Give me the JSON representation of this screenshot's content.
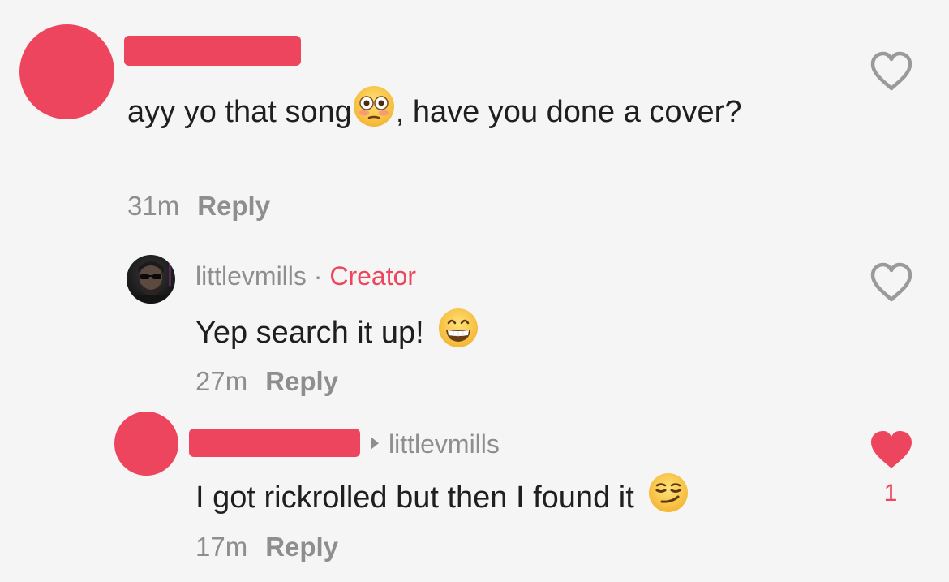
{
  "comments": [
    {
      "text_before_emoji": "ayy yo that song",
      "emoji": "flushed-face-emoji",
      "text_after_emoji": ", have you done a cover?",
      "time": "31m",
      "reply_label": "Reply",
      "liked": false
    },
    {
      "username": "littlevmills",
      "separator": "·",
      "badge": "Creator",
      "text": "Yep search it up!",
      "emoji": "grinning-face-emoji",
      "time": "27m",
      "reply_label": "Reply",
      "liked": false
    },
    {
      "replying_to": "littlevmills",
      "text": "I got rickrolled but then I found it",
      "emoji": "smirking-face-emoji",
      "time": "17m",
      "reply_label": "Reply",
      "liked": true,
      "like_count": "1"
    }
  ],
  "colors": {
    "accent": "#ec455d",
    "text": "#1f1f1f",
    "meta": "#8e8e8e",
    "background": "#f5f5f5"
  }
}
